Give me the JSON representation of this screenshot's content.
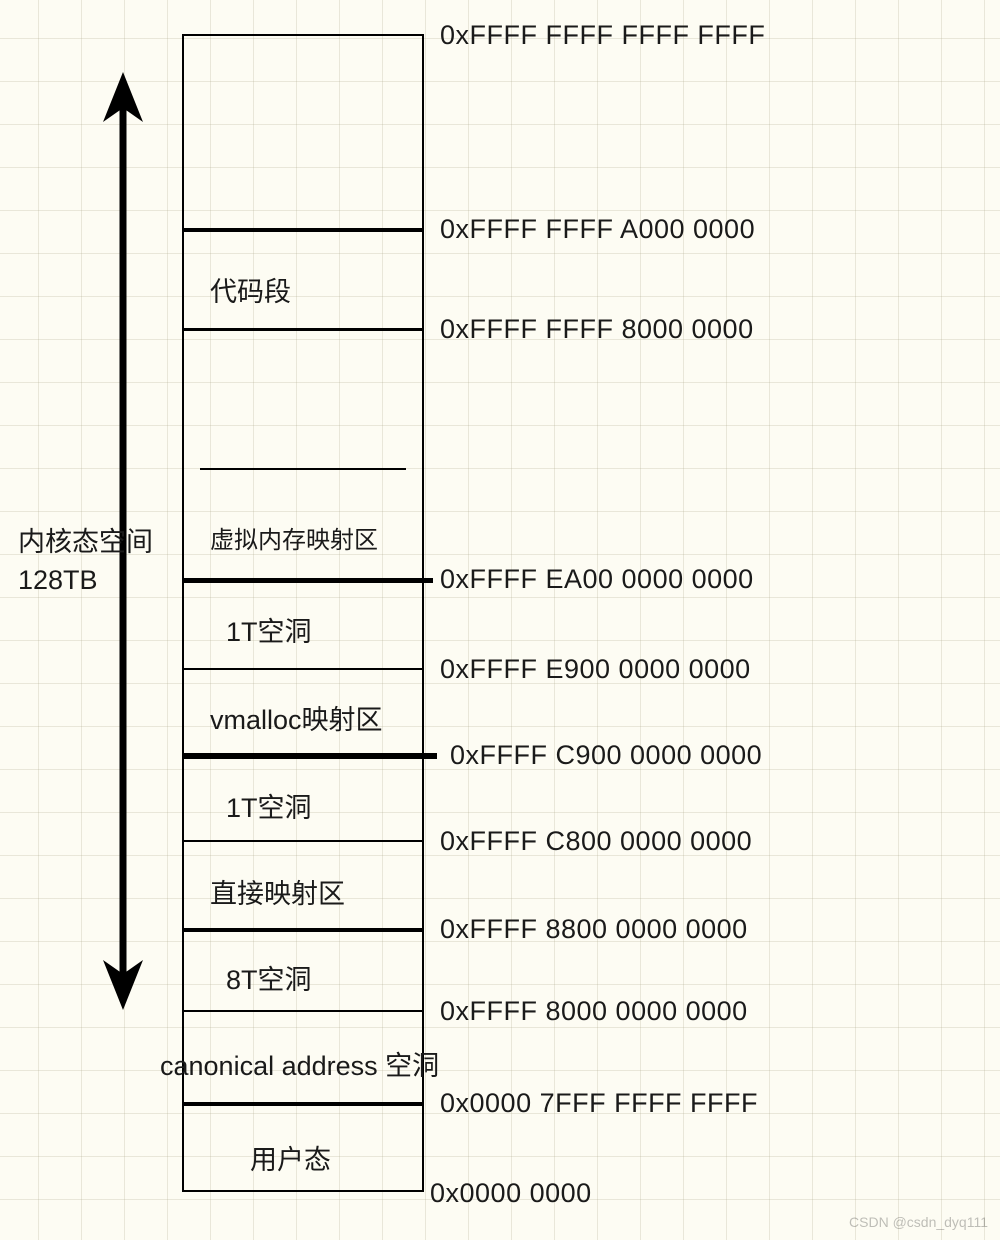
{
  "sideLabel": {
    "line1": "内核态空间",
    "line2": "128TB"
  },
  "addresses": {
    "top": "0xFFFF FFFF FFFF FFFF",
    "a000": "0xFFFF FFFF A000 0000",
    "eight000": "0xFFFF FFFF 8000 0000",
    "ea00": "0xFFFF EA00 0000 0000",
    "e900": "0xFFFF E900 0000 0000",
    "c900": "0xFFFF C900 0000 0000",
    "c800": "0xFFFF C800 0000 0000",
    "eight8": "0xFFFF 8800 0000 0000",
    "eight0": "0xFFFF 8000 0000 0000",
    "u7fff": "0x0000 7FFF FFFF FFFF",
    "zero": "0x0000 0000"
  },
  "regions": {
    "codeSeg": "代码段",
    "vmemMap": "虚拟内存映射区",
    "hole1Ta": "1T空洞",
    "vmalloc": "vmalloc映射区",
    "hole1Tb": "1T空洞",
    "directMap": "直接映射区",
    "hole8T": "8T空洞",
    "canonical": "canonical address 空洞",
    "userSpace": "用户态"
  },
  "watermark": "CSDN @csdn_dyq111"
}
